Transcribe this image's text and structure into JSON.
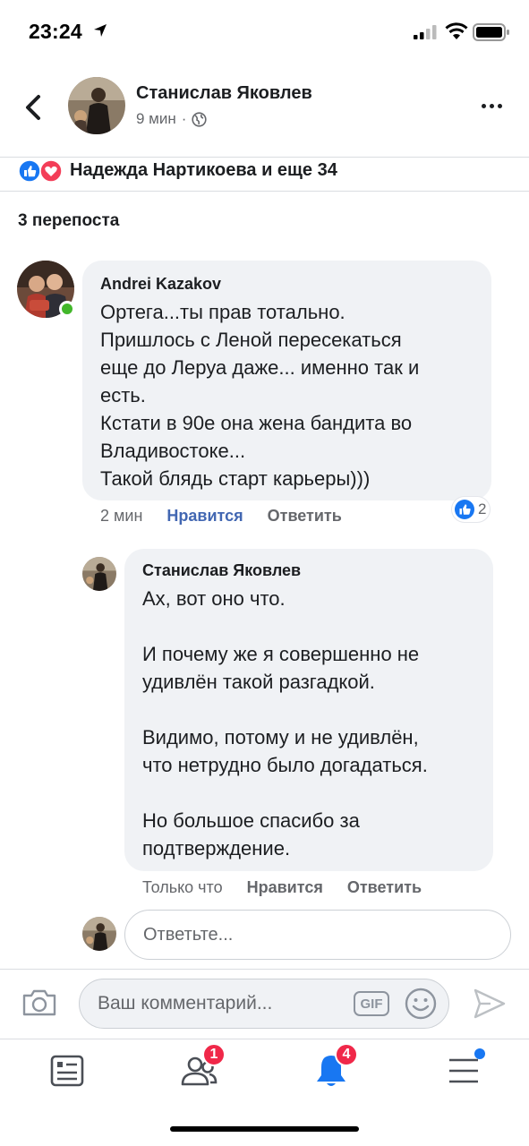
{
  "status_bar": {
    "time": "23:24"
  },
  "header": {
    "author_name": "Станислав Яковлев",
    "post_time": "9 мин",
    "separator": "·"
  },
  "reactions": {
    "summary": "Надежда Нартикоева и еще 34"
  },
  "reposts": "3 перепоста",
  "comments": [
    {
      "author": "Andrei Kazakov",
      "text": "Ортега...ты прав тотально.\nПришлось с Леной пересекаться\nеще до Леруа даже... именно так и\nесть.\nКстати в 90е она жена бандита во\nВладивостоке...\nТакой блядь старт карьеры)))",
      "time": "2 мин",
      "like_label": "Нравится",
      "reply_label": "Ответить",
      "reaction_count": "2"
    }
  ],
  "reply": {
    "author": "Станислав Яковлев",
    "text": "Ах, вот оно что.\n\nИ почему же я совершенно не\nудивлён такой   разгадкой.\n\nВидимо, потому и не удивлён,\nчто нетрудно было догадаться.\n\nНо большое спасибо за\nподтверждение.",
    "time": "Только что",
    "like_label": "Нравится",
    "reply_label": "Ответить"
  },
  "reply_input": {
    "placeholder": "Ответьте..."
  },
  "comment_bar": {
    "placeholder": "Ваш комментарий...",
    "gif_label": "GIF"
  },
  "tabs": [
    {
      "icon": "news-feed-icon"
    },
    {
      "icon": "friends-icon",
      "badge": "1"
    },
    {
      "icon": "notifications-bell-icon",
      "badge": "4"
    },
    {
      "icon": "menu-icon"
    }
  ],
  "colors": {
    "accent": "#4267b2",
    "like_blue": "#1877f2",
    "badge_red": "#f02849",
    "online_green": "#42b72a",
    "bubble": "#f0f2f5"
  }
}
